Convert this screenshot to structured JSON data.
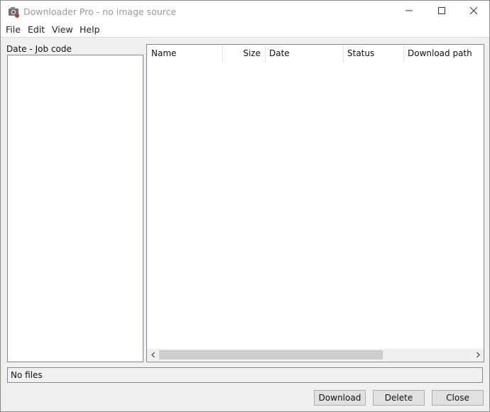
{
  "window": {
    "title": "Downloader Pro - no image source"
  },
  "menu": {
    "items": [
      "File",
      "Edit",
      "View",
      "Help"
    ]
  },
  "left_panel": {
    "label": "Date - Job code"
  },
  "file_list": {
    "columns": [
      "Name",
      "Size",
      "Date",
      "Status",
      "Download path"
    ],
    "rows": []
  },
  "status": {
    "text": "No files"
  },
  "buttons": {
    "download": "Download",
    "delete": "Delete",
    "close": "Close"
  },
  "icons": {
    "app": "camera-download-icon",
    "minimize": "minimize-icon",
    "maximize": "maximize-icon",
    "close": "close-icon",
    "scroll_left": "chevron-left-icon",
    "scroll_right": "chevron-right-icon"
  }
}
